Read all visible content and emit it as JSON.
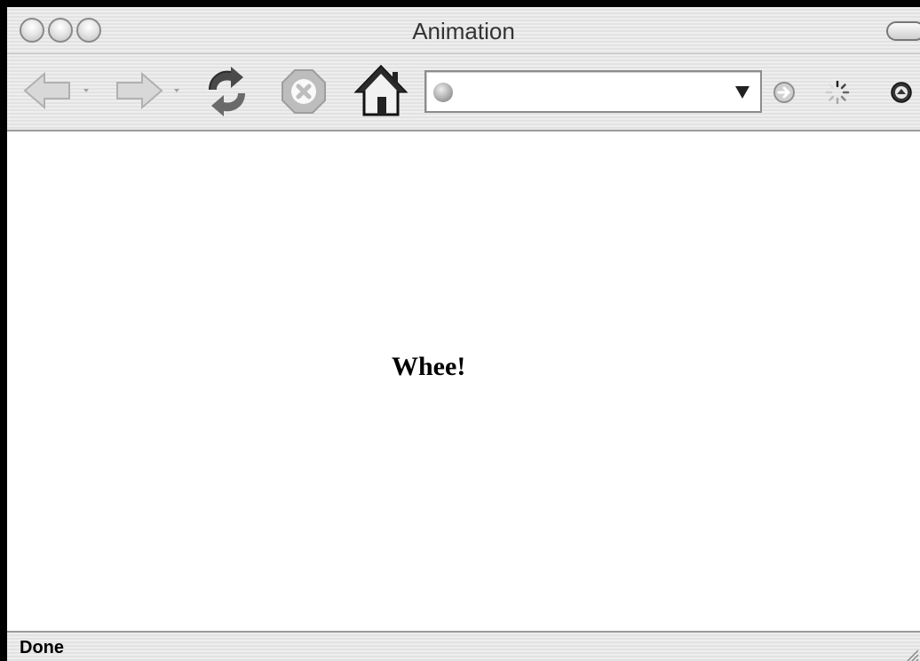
{
  "window": {
    "title": "Animation"
  },
  "toolbar": {
    "buttons": [
      {
        "name": "back",
        "icon": "back-arrow-icon"
      },
      {
        "name": "forward",
        "icon": "forward-arrow-icon"
      },
      {
        "name": "reload",
        "icon": "reload-icon"
      },
      {
        "name": "stop",
        "icon": "stop-icon"
      },
      {
        "name": "home",
        "icon": "home-icon"
      }
    ],
    "url": {
      "value": "",
      "icon": "globe-icon"
    },
    "go_icon": "go-arrow-icon",
    "throbber_icon": "throbber-icon",
    "menu_icon": "menu-icon"
  },
  "content": {
    "text": "Whee!"
  },
  "status": {
    "text": "Done"
  }
}
